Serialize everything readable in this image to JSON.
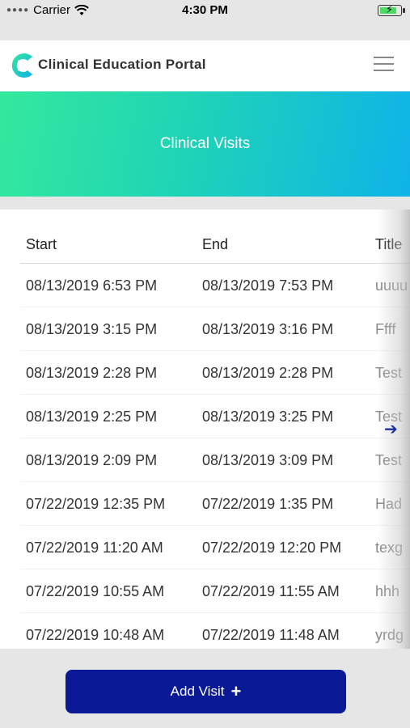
{
  "status_bar": {
    "carrier": "Carrier",
    "time": "4:30 PM",
    "battery_level": 0.85
  },
  "header": {
    "brand": "Clinical Education Portal"
  },
  "banner": {
    "title": "Clinical Visits"
  },
  "table": {
    "columns": {
      "start": "Start",
      "end": "End",
      "title": "Title"
    },
    "rows": [
      {
        "start": "08/13/2019 6:53 PM",
        "end": "08/13/2019 7:53 PM",
        "title": "uuuu"
      },
      {
        "start": "08/13/2019 3:15 PM",
        "end": "08/13/2019 3:16 PM",
        "title": "Ffff"
      },
      {
        "start": "08/13/2019 2:28 PM",
        "end": "08/13/2019 2:28 PM",
        "title": "Test"
      },
      {
        "start": "08/13/2019 2:25 PM",
        "end": "08/13/2019 3:25 PM",
        "title": "Test"
      },
      {
        "start": "08/13/2019 2:09 PM",
        "end": "08/13/2019 3:09 PM",
        "title": "Test"
      },
      {
        "start": "07/22/2019 12:35 PM",
        "end": "07/22/2019 1:35 PM",
        "title": "Had"
      },
      {
        "start": "07/22/2019 11:20 AM",
        "end": "07/22/2019 12:20 PM",
        "title": "texg"
      },
      {
        "start": "07/22/2019 10:55 AM",
        "end": "07/22/2019 11:55 AM",
        "title": "hhh"
      },
      {
        "start": "07/22/2019 10:48 AM",
        "end": "07/22/2019 11:48 AM",
        "title": "yrdg"
      }
    ]
  },
  "footer": {
    "add_visit_label": "Add Visit"
  },
  "icons": {
    "wifi": "wifi-icon",
    "battery": "battery-icon",
    "logo": "portal-logo",
    "menu": "hamburger-menu-icon",
    "scroll": "arrow-right-icon",
    "add": "plus-icon"
  },
  "colors": {
    "primary_button": "#0a1a96",
    "gradient_start": "#34e89e",
    "gradient_end": "#0fb3e8"
  }
}
